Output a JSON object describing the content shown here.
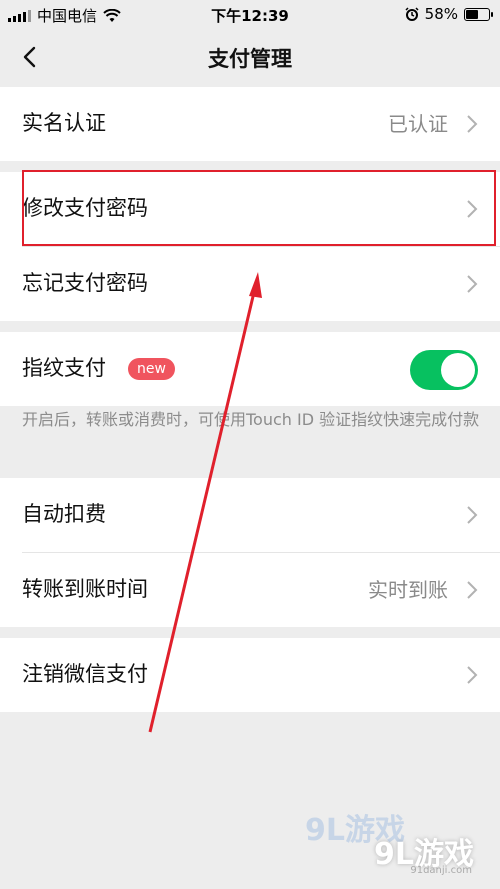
{
  "status_bar": {
    "carrier": "中国电信",
    "time": "下午12:39",
    "battery_text": "58%",
    "battery_level": 0.58
  },
  "nav": {
    "title": "支付管理",
    "back_icon": "chevron-left-icon"
  },
  "groups": [
    {
      "items": [
        {
          "label": "实名认证",
          "value": "已认证"
        }
      ]
    },
    {
      "items": [
        {
          "label": "修改支付密码",
          "value": ""
        },
        {
          "label": "忘记支付密码",
          "value": ""
        }
      ]
    },
    {
      "items": [
        {
          "label": "指纹支付",
          "badge": "new",
          "toggle_on": true
        }
      ]
    },
    {
      "items": [
        {
          "label": "自动扣费",
          "value": ""
        },
        {
          "label": "转账到账时间",
          "value": "实时到账"
        }
      ]
    },
    {
      "items": [
        {
          "label": "注销微信支付",
          "value": ""
        }
      ]
    }
  ],
  "fingerprint_hint": "开启后，转账或消费时，可使用Touch ID 验证指纹快速完成付款",
  "colors": {
    "toggle_on": "#07c160",
    "badge": "#f0545e",
    "annotation": "#e0202c",
    "background": "#ededed"
  },
  "watermark": {
    "text": "9L游戏",
    "url": "91danji.com"
  }
}
